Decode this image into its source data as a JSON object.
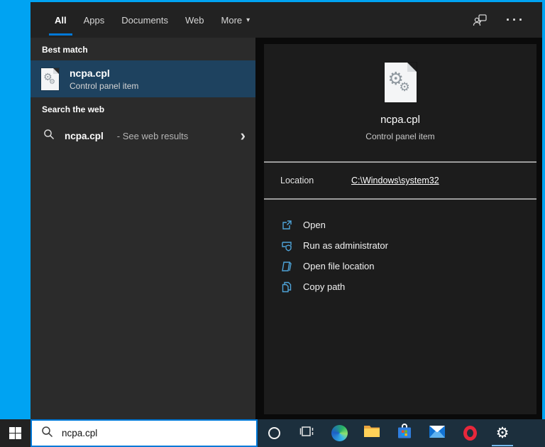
{
  "desktop": {
    "background_color": "#00a3f2",
    "accent_color": "#0078d7"
  },
  "search_flyout": {
    "tabs": [
      {
        "label": "All",
        "active": true
      },
      {
        "label": "Apps",
        "active": false
      },
      {
        "label": "Documents",
        "active": false
      },
      {
        "label": "Web",
        "active": false
      },
      {
        "label": "More",
        "active": false
      }
    ],
    "icons": {
      "more_dropdown": "▾",
      "ellipsis": "···",
      "chevron_right": "›",
      "gear_glyph": "⚙"
    },
    "results": {
      "best_match": {
        "section_label": "Best match",
        "item": {
          "title": "ncpa.cpl",
          "subtitle": "Control panel item",
          "icon": "control-panel-file-icon",
          "selected": true,
          "highlight_color": "#1e425f"
        }
      },
      "web": {
        "section_label": "Search the web",
        "item": {
          "query": "ncpa.cpl",
          "suffix": "- See web results",
          "icon": "search-icon"
        }
      }
    },
    "preview": {
      "icon": "control-panel-file-icon",
      "title": "ncpa.cpl",
      "subtitle": "Control panel item",
      "location": {
        "label": "Location",
        "value": "C:\\Windows\\system32"
      },
      "actions": [
        {
          "label": "Open",
          "icon": "open-icon"
        },
        {
          "label": "Run as administrator",
          "icon": "shield-icon"
        },
        {
          "label": "Open file location",
          "icon": "folder-icon"
        },
        {
          "label": "Copy path",
          "icon": "copy-icon"
        }
      ],
      "action_icon_color": "#4ea3d8"
    }
  },
  "taskbar": {
    "search_box": {
      "value": "ncpa.cpl",
      "icon": "search-icon"
    },
    "icons": [
      "cortana",
      "task-view",
      "edge",
      "file-explorer",
      "microsoft-store",
      "mail",
      "opera",
      "settings"
    ],
    "active_app": "settings"
  }
}
